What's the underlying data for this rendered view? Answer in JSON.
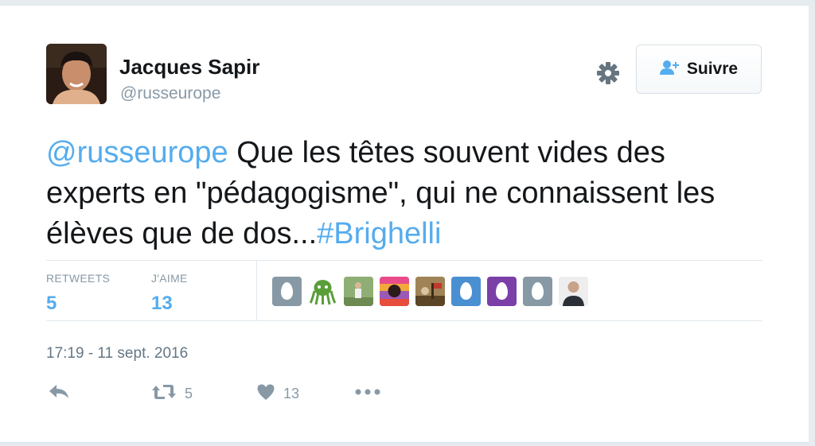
{
  "tweet": {
    "author": {
      "name": "Jacques Sapir",
      "handle": "@russeurope"
    },
    "follow_label": "Suivre",
    "text_parts": {
      "mention": "@russeurope",
      "body": " Que les têtes souvent vides des experts en \"pédagogisme\", qui ne connaissent les élèves que de dos...",
      "hashtag": "#Brighelli"
    },
    "stats": {
      "retweets_label": "RETWEETS",
      "retweets_count": "5",
      "likes_label": "J'AIME",
      "likes_count": "13"
    },
    "likers": [
      {
        "icon": "egg-avatar-icon",
        "color": "#8899a6"
      },
      {
        "icon": "green-octopus-avatar-icon",
        "color": "#5a9e3a"
      },
      {
        "icon": "photo-avatar-icon",
        "color": "#7e9a6b"
      },
      {
        "icon": "colorful-avatar-icon",
        "color": "#d9468f"
      },
      {
        "icon": "painting-avatar-icon",
        "color": "#8a6a3c"
      },
      {
        "icon": "egg-avatar-icon",
        "color": "#4a8fd1"
      },
      {
        "icon": "egg-avatar-icon",
        "color": "#7b3fa8"
      },
      {
        "icon": "egg-avatar-icon",
        "color": "#8899a6"
      },
      {
        "icon": "person-avatar-icon",
        "color": "#e6e6e6"
      }
    ],
    "timestamp": "17:19 - 11 sept. 2016",
    "actions": {
      "retweet_count": "5",
      "like_count": "13"
    },
    "colors": {
      "link": "#55acee",
      "text": "#14171a",
      "muted": "#8899a6"
    }
  }
}
